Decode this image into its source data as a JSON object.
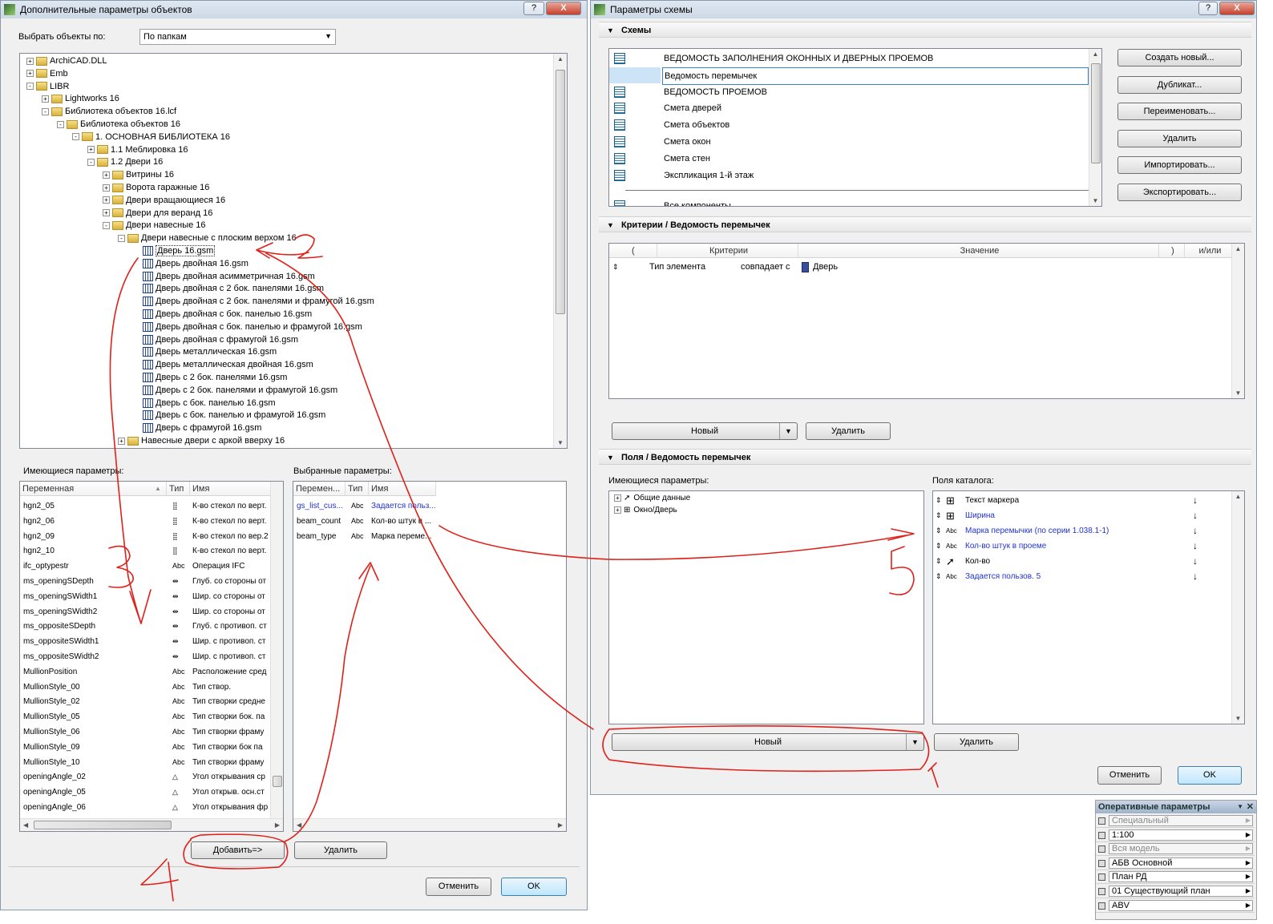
{
  "left_dialog": {
    "title": "Дополнительные параметры объектов",
    "help_label": "?",
    "close_label": "X",
    "select_by_label": "Выбрать объекты по:",
    "select_by_value": "По папкам",
    "tree": [
      {
        "label": "ArchiCAD.DLL",
        "depth": 0,
        "kind": "folder",
        "exp": "+"
      },
      {
        "label": "Emb",
        "depth": 0,
        "kind": "folder",
        "exp": "+"
      },
      {
        "label": "LIBR",
        "depth": 0,
        "kind": "folder",
        "exp": "-"
      },
      {
        "label": "Lightworks 16",
        "depth": 1,
        "kind": "folder",
        "exp": "+"
      },
      {
        "label": "Библиотека объектов 16.lcf",
        "depth": 1,
        "kind": "folder",
        "exp": "-"
      },
      {
        "label": "Библиотека объектов 16",
        "depth": 2,
        "kind": "folder",
        "exp": "-"
      },
      {
        "label": "1. ОСНОВНАЯ БИБЛИОТЕКА  16",
        "depth": 3,
        "kind": "folder",
        "exp": "-"
      },
      {
        "label": "1.1 Меблировка  16",
        "depth": 4,
        "kind": "folder",
        "exp": "+"
      },
      {
        "label": "1.2 Двери  16",
        "depth": 4,
        "kind": "folder",
        "exp": "-"
      },
      {
        "label": "Витрины 16",
        "depth": 5,
        "kind": "folder",
        "exp": "+"
      },
      {
        "label": "Ворота гаражные  16",
        "depth": 5,
        "kind": "folder",
        "exp": "+"
      },
      {
        "label": "Двери вращающиеся  16",
        "depth": 5,
        "kind": "folder",
        "exp": "+"
      },
      {
        "label": "Двери для веранд  16",
        "depth": 5,
        "kind": "folder",
        "exp": "+"
      },
      {
        "label": "Двери навесные  16",
        "depth": 5,
        "kind": "folder",
        "exp": "-"
      },
      {
        "label": "Двери навесные с плоским верхом  16",
        "depth": 6,
        "kind": "folder",
        "exp": "-"
      },
      {
        "label": "Дверь 16.gsm",
        "depth": 7,
        "kind": "gsm",
        "selected": true
      },
      {
        "label": "Дверь двойная   16.gsm",
        "depth": 7,
        "kind": "gsm"
      },
      {
        "label": "Дверь двойная асимметричная 16.gsm",
        "depth": 7,
        "kind": "gsm"
      },
      {
        "label": "Дверь двойная с 2 бок. панелями 16.gsm",
        "depth": 7,
        "kind": "gsm"
      },
      {
        "label": "Дверь двойная с 2 бок. панелями и фрамугой 16.gsm",
        "depth": 7,
        "kind": "gsm"
      },
      {
        "label": "Дверь двойная с бок. панелью 16.gsm",
        "depth": 7,
        "kind": "gsm"
      },
      {
        "label": "Дверь двойная с бок. панелью и фрамугой 16.gsm",
        "depth": 7,
        "kind": "gsm"
      },
      {
        "label": "Дверь двойная с фрамугой 16.gsm",
        "depth": 7,
        "kind": "gsm"
      },
      {
        "label": "Дверь металлическая 16.gsm",
        "depth": 7,
        "kind": "gsm"
      },
      {
        "label": "Дверь металлическая двойная 16.gsm",
        "depth": 7,
        "kind": "gsm"
      },
      {
        "label": "Дверь с 2 бок. панелями 16.gsm",
        "depth": 7,
        "kind": "gsm"
      },
      {
        "label": "Дверь с 2 бок. панелями и фрамугой 16.gsm",
        "depth": 7,
        "kind": "gsm"
      },
      {
        "label": "Дверь с бок. панелью 16.gsm",
        "depth": 7,
        "kind": "gsm"
      },
      {
        "label": "Дверь с бок. панелью и фрамугой 16.gsm",
        "depth": 7,
        "kind": "gsm"
      },
      {
        "label": "Дверь с фрамугой 16.gsm",
        "depth": 7,
        "kind": "gsm"
      },
      {
        "label": "Навесные двери с аркой вверху  16",
        "depth": 6,
        "kind": "folder",
        "exp": "+"
      }
    ],
    "available_params_label": "Имеющиеся параметры:",
    "available_headers": {
      "var": "Переменная",
      "type": "Тип",
      "name": "Имя"
    },
    "available_params": [
      {
        "var": "hgn2_05",
        "type": "grid",
        "name": "К-во стекол по верт."
      },
      {
        "var": "hgn2_06",
        "type": "grid",
        "name": "К-во стекол по верт."
      },
      {
        "var": "hgn2_09",
        "type": "grid",
        "name": "К-во стекол по вер.2"
      },
      {
        "var": "hgn2_10",
        "type": "grid",
        "name": "К-во стекол по верт."
      },
      {
        "var": "ifc_optypestr",
        "type": "Abc",
        "name": "Операция IFC"
      },
      {
        "var": "ms_openingSDepth",
        "type": "dim",
        "name": "Глуб. со стороны от"
      },
      {
        "var": "ms_openingSWidth1",
        "type": "dim",
        "name": "Шир. со стороны от"
      },
      {
        "var": "ms_openingSWidth2",
        "type": "dim",
        "name": "Шир. со стороны от"
      },
      {
        "var": "ms_oppositeSDepth",
        "type": "dim",
        "name": "Глуб. с противоп. ст"
      },
      {
        "var": "ms_oppositeSWidth1",
        "type": "dim",
        "name": "Шир. с противоп. ст"
      },
      {
        "var": "ms_oppositeSWidth2",
        "type": "dim",
        "name": "Шир. с противоп. ст"
      },
      {
        "var": "MullionPosition",
        "type": "Abc",
        "name": "Расположение сред"
      },
      {
        "var": "MullionStyle_00",
        "type": "Abc",
        "name": "Тип створ."
      },
      {
        "var": "MullionStyle_02",
        "type": "Abc",
        "name": "Тип створки средне"
      },
      {
        "var": "MullionStyle_05",
        "type": "Abc",
        "name": "Тип створки бок. па"
      },
      {
        "var": "MullionStyle_06",
        "type": "Abc",
        "name": "Тип створки фраму"
      },
      {
        "var": "MullionStyle_09",
        "type": "Abc",
        "name": "Тип створки бок па"
      },
      {
        "var": "MullionStyle_10",
        "type": "Abc",
        "name": "Тип створки фраму"
      },
      {
        "var": "openingAngle_02",
        "type": "angle",
        "name": "Угол открывания ср"
      },
      {
        "var": "openingAngle_05",
        "type": "angle",
        "name": "Угол открыв. осн.ст"
      },
      {
        "var": "openingAngle_06",
        "type": "angle",
        "name": "Угол открывания фр"
      }
    ],
    "selected_params_label": "Выбранные параметры:",
    "selected_headers": {
      "var": "Перемен...",
      "type": "Тип",
      "name": "Имя"
    },
    "selected_params": [
      {
        "var": "gs_list_cus...",
        "type": "Abc",
        "name": "Задается польз...",
        "blue": true
      },
      {
        "var": "beam_count",
        "type": "Abc",
        "name": "Кол-во штук в ...",
        "blue": false
      },
      {
        "var": "beam_type",
        "type": "Abc",
        "name": "Марка переме...",
        "blue": false
      }
    ],
    "add_button": "Добавить=>",
    "remove_button": "Удалить",
    "cancel_button": "Отменить",
    "ok_button": "OK"
  },
  "right_dialog": {
    "title": "Параметры схемы",
    "help_label": "?",
    "close_label": "X",
    "schemes_section": "Схемы",
    "schemes": [
      {
        "label": "ВЕДОМОСТЬ ЗАПОЛНЕНИЯ ОКОННЫХ И ДВЕРНЫХ ПРОЕМОВ"
      },
      {
        "label": "Ведомость перемычек",
        "selected": true
      },
      {
        "label": "ВЕДОМОСТЬ ПРОЕМОВ"
      },
      {
        "label": "Смета дверей"
      },
      {
        "label": "Смета объектов"
      },
      {
        "label": "Смета окон"
      },
      {
        "label": "Смета стен"
      },
      {
        "label": "Экспликация 1-й этаж"
      },
      {
        "label": "Все компоненты"
      }
    ],
    "scheme_buttons": [
      "Создать новый...",
      "Дубликат...",
      "Переименовать...",
      "Удалить",
      "Импортировать...",
      "Экспортировать..."
    ],
    "criteria_section": "Критерии /  Ведомость перемычек",
    "criteria_headers": {
      "open": "(",
      "criteria": "Критерии",
      "value": "Значение",
      "close": ")",
      "andor": "и/или"
    },
    "criteria_row": {
      "element": "Тип элемента",
      "op": "совпадает с",
      "value": "Дверь"
    },
    "criteria_new": "Новый",
    "criteria_delete": "Удалить",
    "fields_section": "Поля /  Ведомость перемычек",
    "fields_available_label": "Имеющиеся параметры:",
    "fields_available": [
      {
        "label": "Общие данные",
        "icon": "cursor"
      },
      {
        "label": "Окно/Дверь",
        "icon": "window"
      }
    ],
    "catalog_label": "Поля каталога:",
    "catalog_fields": [
      {
        "label": "Текст маркера",
        "icon": "window",
        "blue": false
      },
      {
        "label": "Ширина",
        "icon": "window",
        "blue": true
      },
      {
        "label": "Марка перемычки (по серии 1.038.1-1)",
        "icon": "Abc",
        "blue": true
      },
      {
        "label": "Кол-во штук в проеме",
        "icon": "Abc",
        "blue": true
      },
      {
        "label": "Кол-во",
        "icon": "cursor",
        "blue": false
      },
      {
        "label": "Задается пользов. 5",
        "icon": "Abc",
        "blue": true
      }
    ],
    "fields_new": "Новый",
    "fields_delete": "Удалить",
    "cancel_button": "Отменить",
    "ok_button": "OK"
  },
  "quick_options": {
    "title": "Оперативные параметры",
    "rows": [
      {
        "value": "Специальный",
        "disabled": true
      },
      {
        "value": "1:100",
        "disabled": false
      },
      {
        "value": "Вся модель",
        "disabled": true
      },
      {
        "value": "АБВ Основной",
        "disabled": false
      },
      {
        "value": "План РД",
        "disabled": false
      },
      {
        "value": "01 Существующий план",
        "disabled": false
      },
      {
        "value": "ABV",
        "disabled": false
      }
    ]
  },
  "annotations": {
    "n1": "1",
    "n2": "2",
    "n3": "3",
    "n4": "4",
    "n5": "5",
    "color": "#e0201a"
  }
}
